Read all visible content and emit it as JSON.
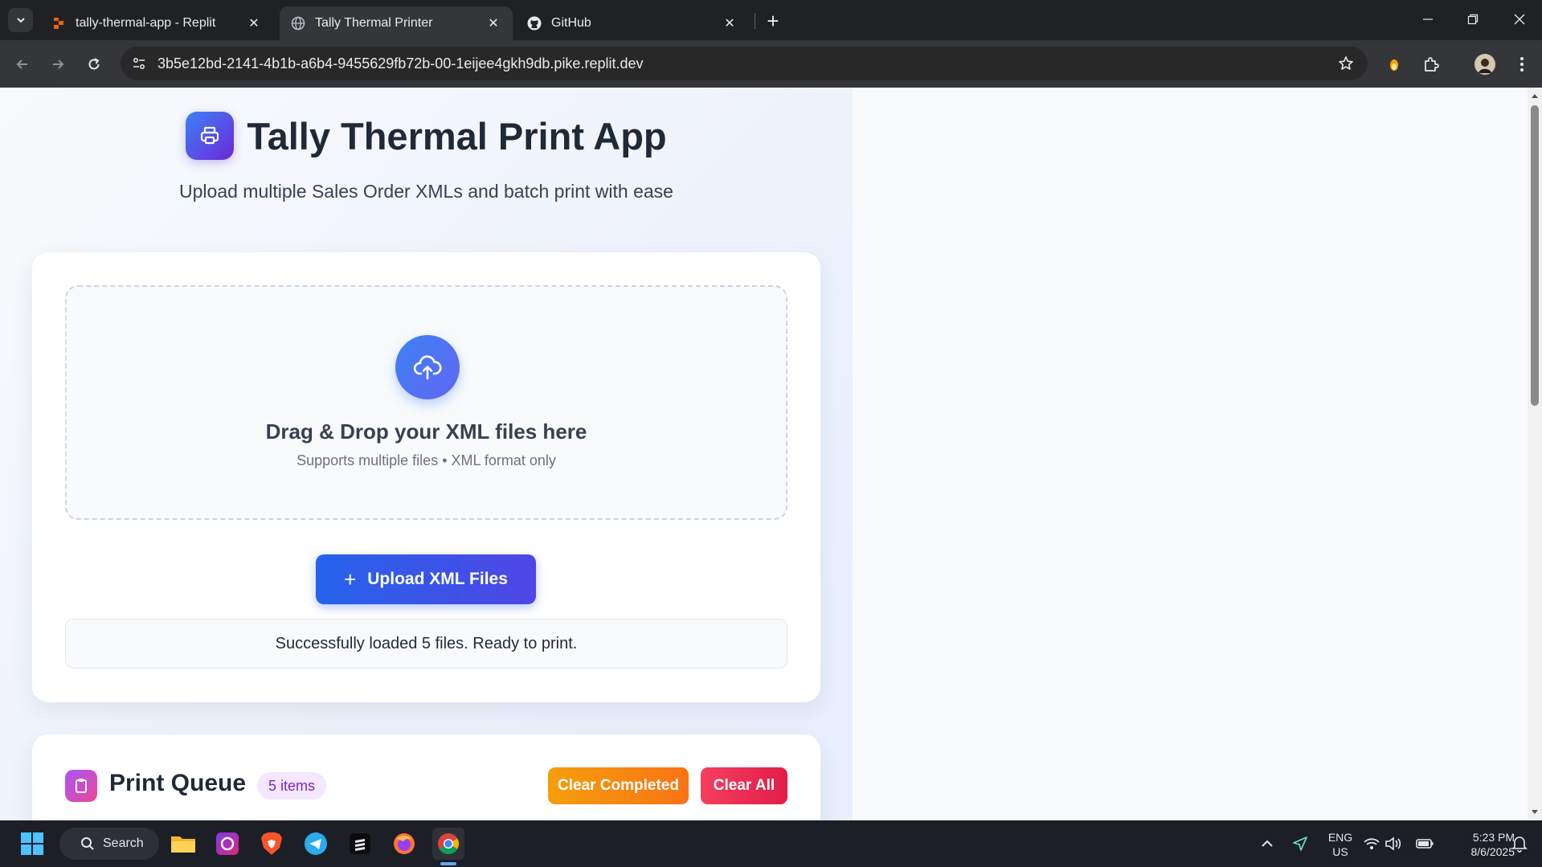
{
  "browser": {
    "tabs": [
      {
        "title": "tally-thermal-app - Replit",
        "active": false
      },
      {
        "title": "Tally Thermal Printer",
        "active": true
      },
      {
        "title": "GitHub",
        "active": false
      }
    ],
    "url": "3b5e12bd-2141-4b1b-a6b4-9455629fb72b-00-1eijee4gkh9db.pike.replit.dev"
  },
  "app": {
    "title": "Tally Thermal Print App",
    "subtitle": "Upload multiple Sales Order XMLs and batch print with ease",
    "dropzone": {
      "title": "Drag & Drop your XML files here",
      "subtitle": "Supports multiple files • XML format only"
    },
    "upload_button": {
      "icon": "+",
      "label": "Upload XML Files"
    },
    "status_message": "Successfully loaded 5 files. Ready to print.",
    "queue": {
      "title": "Print Queue",
      "count_label": "5 items",
      "clear_completed_label": "Clear Completed",
      "clear_all_label": "Clear All"
    }
  },
  "taskbar": {
    "search_label": "Search",
    "lang_line1": "ENG",
    "lang_line2": "US",
    "time": "5:23 PM",
    "date": "8/6/2025"
  },
  "colors": {
    "primary": "#2563eb",
    "accent": "#4f46e5",
    "warning": "#f97316",
    "danger": "#e11d48",
    "badge_bg": "#f3e8ff",
    "badge_text": "#7e22ce"
  }
}
